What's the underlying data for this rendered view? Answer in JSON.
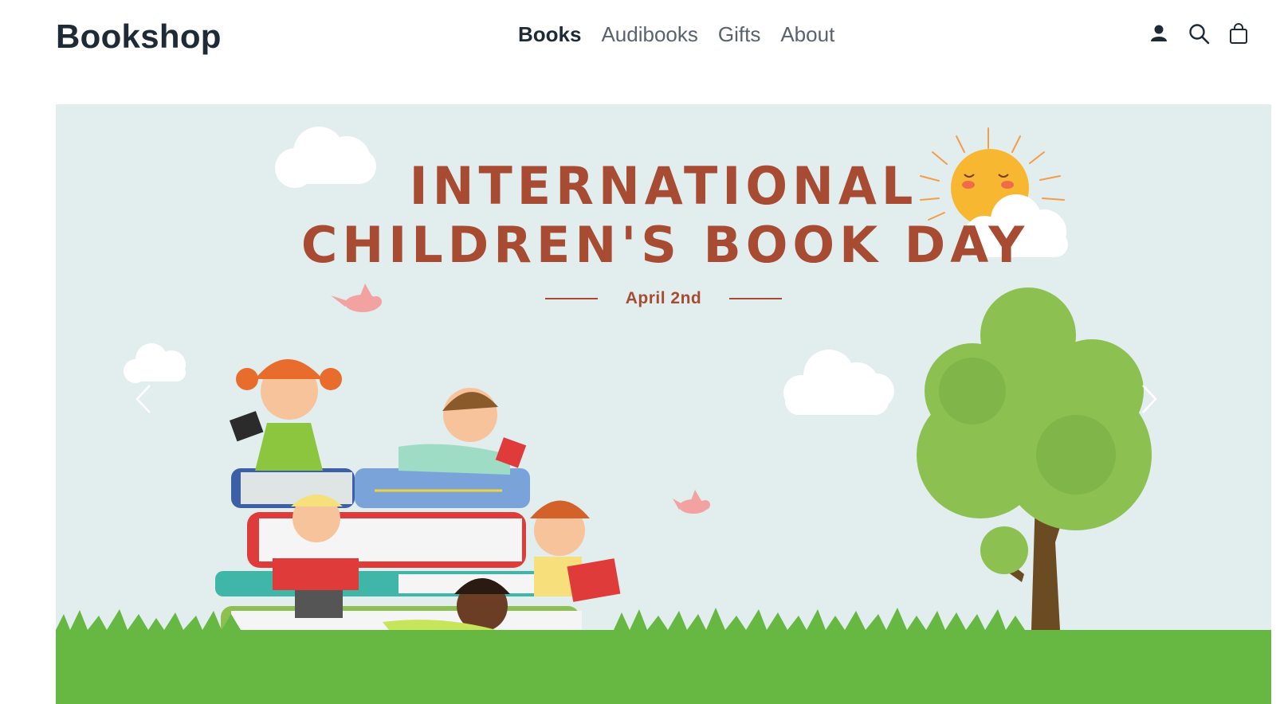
{
  "header": {
    "logo": "Bookshop",
    "nav": [
      {
        "label": "Books",
        "active": true
      },
      {
        "label": "Audibooks",
        "active": false
      },
      {
        "label": "Gifts",
        "active": false
      },
      {
        "label": "About",
        "active": false
      }
    ],
    "icons": [
      "user-icon",
      "search-icon",
      "shopping-bag-icon"
    ]
  },
  "hero": {
    "title_line1": "INTERNATIONAL",
    "title_line2": "CHILDREN'S BOOK DAY",
    "date": "April 2nd",
    "prev_icon": "chevron-left-icon",
    "next_icon": "chevron-right-icon",
    "colors": {
      "background": "#e2edee",
      "title": "#a74b33",
      "grass": "#66b843",
      "tree": "#8cc152",
      "sun": "#f7b731"
    }
  }
}
